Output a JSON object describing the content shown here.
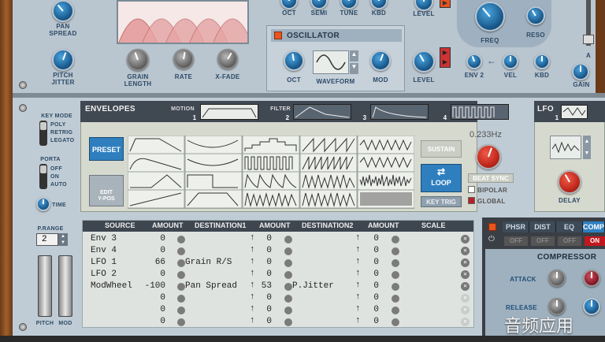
{
  "top": {
    "pan_spread": "PAN\nSPREAD",
    "pitch_jitter": "PITCH\nJITTER",
    "grain_length": "GRAIN\nLENGTH",
    "rate": "RATE",
    "xfade": "X-FADE",
    "oct": "OCT",
    "semi": "SEMI",
    "tune": "TUNE",
    "kbd": "KBD",
    "level": "LEVEL",
    "freq": "FREQ",
    "reso": "RESO",
    "env2": "ENV 2",
    "vel": "VEL",
    "kbd2": "KBD",
    "gain": "GAIN",
    "a": "A",
    "oscillator_title": "OSCILLATOR",
    "osc_oct": "OCT",
    "waveform": "WAVEFORM",
    "mod": "MOD",
    "level2": "LEVEL"
  },
  "key_section": {
    "key_mode": "KEY MODE",
    "poly": "POLY",
    "retrig": "RETRIG",
    "legato": "LEGATO",
    "porta": "PORTA",
    "off": "OFF",
    "on": "ON",
    "auto": "AUTO",
    "time": "TIME",
    "prange": "P.RANGE",
    "prange_value": "2",
    "pitch": "PITCH",
    "mod": "MOD"
  },
  "envelopes": {
    "title": "ENVELOPES",
    "motion": "MOTION",
    "tab1": "1",
    "filter": "FILTER",
    "tab2": "2",
    "tab3": "3",
    "tab4": "4",
    "preset": "PRESET",
    "edit_ypos": "EDIT\nY-POS",
    "sustain": "SUSTAIN",
    "loop": "LOOP",
    "key_trig": "KEY TRIG",
    "rate_value": "0.233Hz",
    "beat_sync": "BEAT SYNC",
    "bipolar": "BIPOLAR",
    "global": "GLOBAL"
  },
  "lfo": {
    "title": "LFO",
    "tab1": "1",
    "delay": "DELAY"
  },
  "mod_matrix": {
    "headers": [
      "SOURCE",
      "AMOUNT",
      "DESTINATION1",
      "AMOUNT",
      "DESTINATION2",
      "AMOUNT",
      "SCALE"
    ],
    "rows": [
      {
        "source": "Env 3",
        "amt1": "0",
        "dest1": "",
        "amt2": "0",
        "dest2": "",
        "amt3": "0"
      },
      {
        "source": "Env 4",
        "amt1": "0",
        "dest1": "",
        "amt2": "0",
        "dest2": "",
        "amt3": "0"
      },
      {
        "source": "LFO 1",
        "amt1": "66",
        "dest1": "Grain R/S",
        "amt2": "0",
        "dest2": "",
        "amt3": "0"
      },
      {
        "source": "LFO 2",
        "amt1": "0",
        "dest1": "",
        "amt2": "0",
        "dest2": "",
        "amt3": "0"
      },
      {
        "source": "ModWheel",
        "amt1": "-100",
        "dest1": "Pan Spread",
        "amt2": "53",
        "dest2": "P.Jitter",
        "amt3": "0"
      },
      {
        "source": "",
        "amt1": "0",
        "dest1": "",
        "amt2": "0",
        "dest2": "",
        "amt3": "0"
      },
      {
        "source": "",
        "amt1": "0",
        "dest1": "",
        "amt2": "0",
        "dest2": "",
        "amt3": "0"
      },
      {
        "source": "",
        "amt1": "0",
        "dest1": "",
        "amt2": "0",
        "dest2": "",
        "amt3": "0"
      }
    ]
  },
  "fx": {
    "tabs": [
      "PHSR",
      "DIST",
      "EQ",
      "COMP"
    ],
    "states": [
      "OFF",
      "OFF",
      "OFF",
      "ON"
    ],
    "compressor": "COMPRESSOR",
    "attack": "ATTACK",
    "release": "RELEASE"
  },
  "watermark": "音频应用",
  "colors": {
    "panel_bg": "#b9c5cf",
    "env_panel": "#d6d9ce",
    "accent_blue": "#3b8fd1",
    "accent_red": "#d8301f"
  }
}
